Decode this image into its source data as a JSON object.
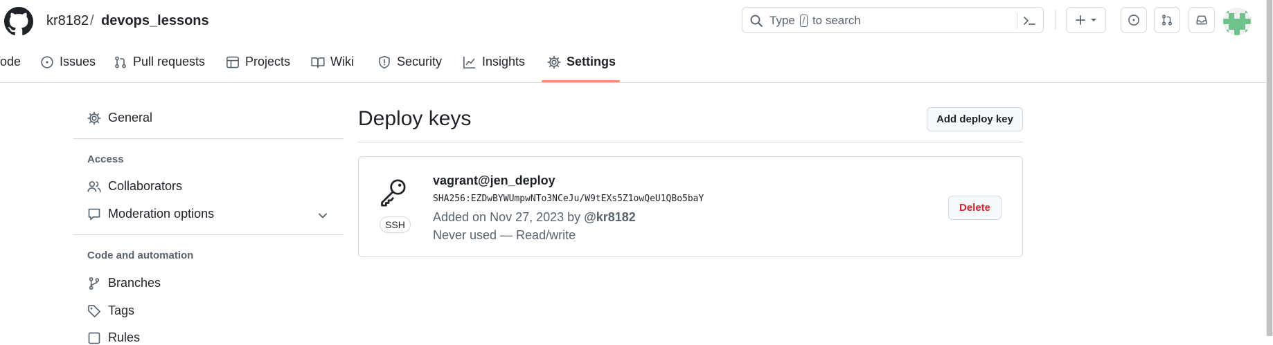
{
  "header": {
    "repo_owner": "kr8182",
    "separator": "/",
    "repo_name": "devops_lessons",
    "search": {
      "prefix": "Type",
      "key": "/",
      "suffix": "to search"
    },
    "icons": [
      "github-logo-icon",
      "search-icon",
      "command-palette-icon",
      "plus-icon",
      "chevron-down-icon",
      "issues-icon",
      "pull-requests-icon",
      "inbox-icon",
      "avatar"
    ]
  },
  "tabs": [
    {
      "label": "ode",
      "icon": "code-icon"
    },
    {
      "label": "Issues",
      "icon": "issue-icon"
    },
    {
      "label": "Pull requests",
      "icon": "pull-request-icon"
    },
    {
      "label": "Projects",
      "icon": "table-icon"
    },
    {
      "label": "Wiki",
      "icon": "book-icon"
    },
    {
      "label": "Security",
      "icon": "shield-icon"
    },
    {
      "label": "Insights",
      "icon": "graph-icon"
    },
    {
      "label": "Settings",
      "icon": "gear-icon",
      "active": true
    }
  ],
  "sidebar": {
    "general": "General",
    "access_heading": "Access",
    "collaborators": "Collaborators",
    "moderation": "Moderation options",
    "code_heading": "Code and automation",
    "branches": "Branches",
    "tags": "Tags",
    "rules": "Rules"
  },
  "main": {
    "title": "Deploy keys",
    "add_button": "Add deploy key",
    "key": {
      "type_badge": "SSH",
      "title": "vagrant@jen_deploy",
      "fingerprint": "SHA256:EZDwBYWUmpwNTo3NCeJu/W9tEXs5Z1owQeU1QBo5baY",
      "added_prefix": "Added on Nov 27, 2023 by",
      "added_by": "@kr8182",
      "usage": "Never used — Read/write",
      "delete_button": "Delete"
    }
  },
  "colors": {
    "accent_underline": "#fd8c73",
    "danger": "#d1242f",
    "border": "#d1d9e0",
    "muted_text": "#59636e"
  }
}
